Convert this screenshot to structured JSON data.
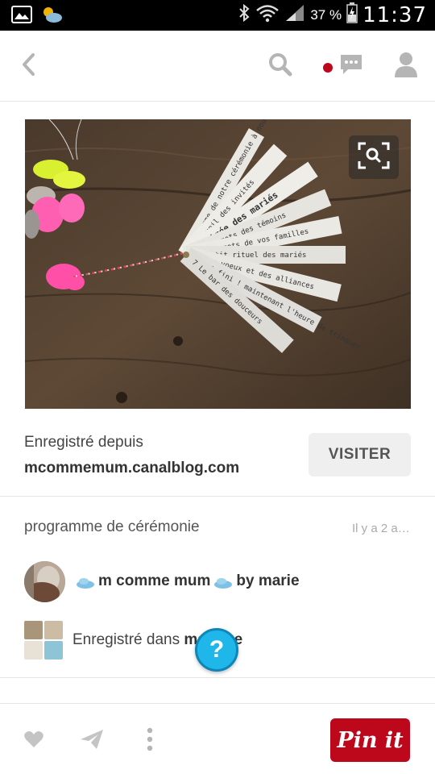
{
  "status_bar": {
    "battery_percent": "37 %",
    "time": "11:37"
  },
  "header": {
    "icons": [
      "back-arrow-icon",
      "search-icon",
      "message-icon",
      "profile-icon"
    ],
    "notification_color": "#bd081c"
  },
  "pin": {
    "image_alt": "Wedding ceremony program fan tags",
    "saved_from_label": "Enregistré depuis",
    "source_domain": "mcommemum.canalblog.com",
    "visit_label": "VISITER",
    "description": "programme de cérémonie",
    "time_ago": "Il y a 2 a…",
    "pinner_name": "m comme mum",
    "pinner_by": "by marie",
    "saved_in_label": "Enregistré dans",
    "board_name": "mariage",
    "photo_texts": [
      "programme de notre cérémonie à nous",
      "1 Accueil des invités",
      "2 Entrée des mariés",
      "3 Les mots des témoins",
      "4 Les mots de vos familles",
      "5 Petit rituel des mariés",
      "6 Les voeux et des alliances",
      "C'est fini ! maintenant l'heure de trinquer",
      "7 Le bar des douceurs"
    ]
  },
  "fab": {
    "label": "?"
  },
  "bottom_bar": {
    "pin_it_label": "Pin it",
    "brand_color": "#bd081c"
  }
}
